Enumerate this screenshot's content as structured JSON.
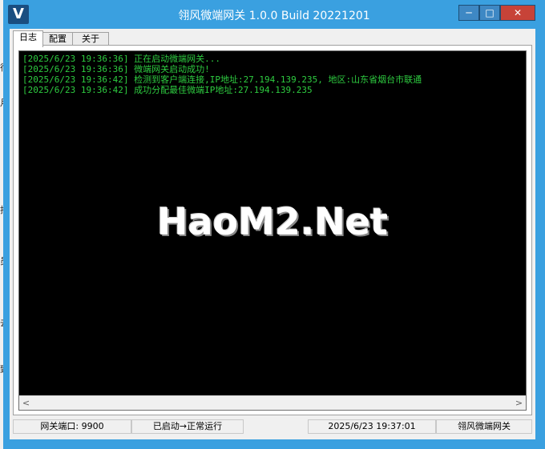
{
  "window": {
    "title": "翎风微端网关 1.0.0 Build 20221201",
    "icon_letter": "V",
    "buttons": {
      "minimize": "─",
      "maximize": "□",
      "close": "✕"
    }
  },
  "background_app": {
    "visible_chars": [
      "行",
      "月",
      "择",
      "员",
      "去",
      "致"
    ]
  },
  "tabs": [
    {
      "label": "日志",
      "active": true
    },
    {
      "label": "配置",
      "active": false
    },
    {
      "label": "关于",
      "active": false
    }
  ],
  "log": {
    "lines": [
      "[2025/6/23 19:36:36] 正在启动微端网关...",
      "[2025/6/23 19:36:36] 微端网关启动成功!",
      "[2025/6/23 19:36:42] 检测到客户端连接,IP地址:27.194.139.235, 地区:山东省烟台市联通",
      "[2025/6/23 19:36:42] 成功分配最佳微端IP地址:27.194.139.235"
    ],
    "text_color": "#2ecc40",
    "background_color": "#000000"
  },
  "watermark": "HaoM2.Net",
  "scrollbar": {
    "left_arrow": "<",
    "right_arrow": ">"
  },
  "status_bar": {
    "port": "网关端口: 9900",
    "state": "已启动→正常运行",
    "time": "2025/6/23 19:37:01",
    "app_name": "翎风微端网关"
  },
  "colors": {
    "title_bar": "#3aa0e0",
    "close_button": "#c74338"
  }
}
